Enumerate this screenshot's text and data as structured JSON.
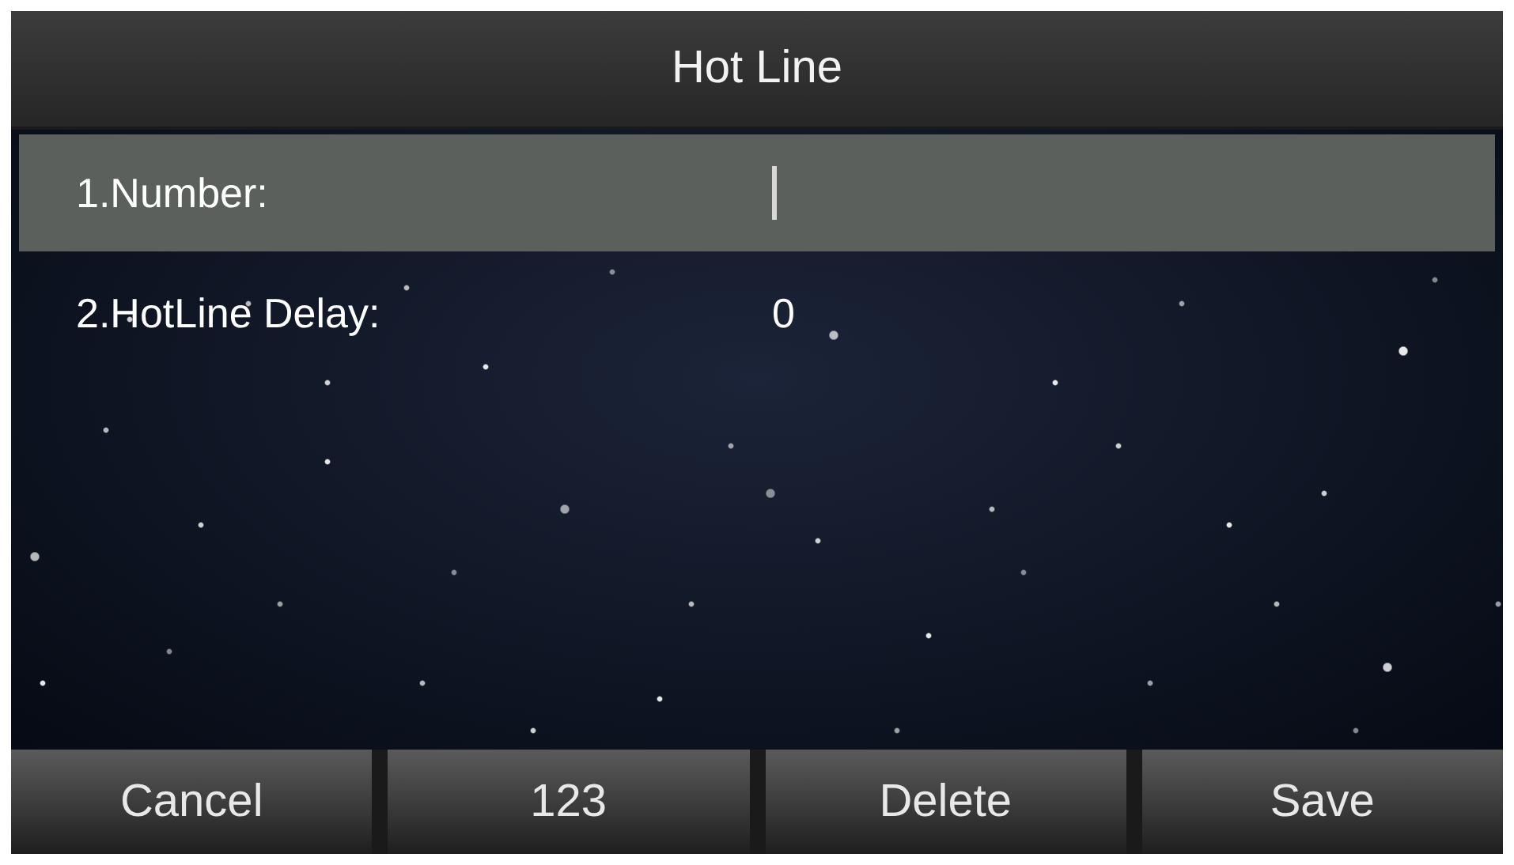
{
  "title": "Hot Line",
  "fields": [
    {
      "label": "1.Number:",
      "selected": true
    },
    {
      "label": "2.HotLine Delay:",
      "value": "0",
      "selected": false
    }
  ],
  "softkeys": [
    "Cancel",
    "123",
    "Delete",
    "Save"
  ]
}
